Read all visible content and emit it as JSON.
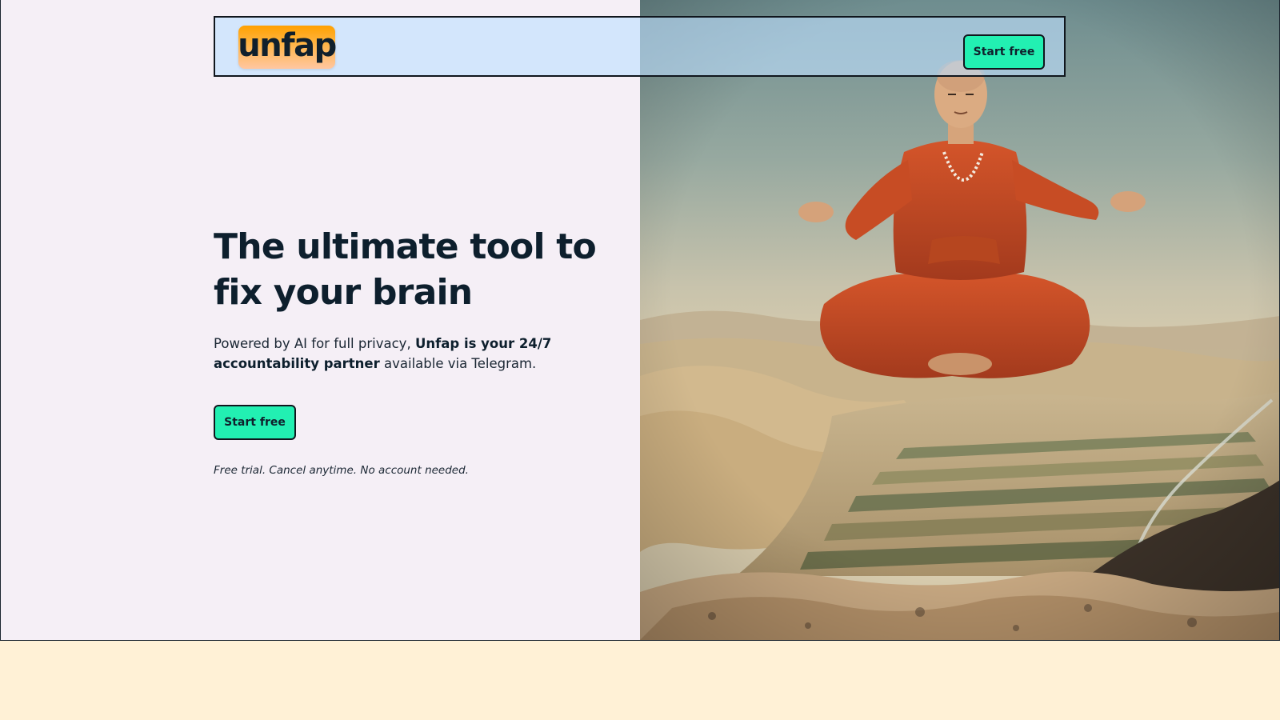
{
  "header": {
    "logo_text": "unfap",
    "cta_label": "Start free"
  },
  "hero": {
    "headline": "The ultimate tool to fix your brain",
    "subtext_lead": "Powered by AI for full privacy, ",
    "subtext_bold": "Unfap is your 24/7 accountability partner",
    "subtext_tail": " available via Telegram.",
    "cta_label": "Start free",
    "note": "Free trial. Cancel anytime. No account needed."
  },
  "image": {
    "subject": "monk-levitating-over-desert-valley"
  },
  "colors": {
    "accent": "#22f0b2",
    "hero_background": "#f5eff6",
    "page_background": "#fff1d6",
    "header_tint": "#bee0ff",
    "logo_orange": "#ffa100",
    "text_dark": "#0d1f2d"
  }
}
